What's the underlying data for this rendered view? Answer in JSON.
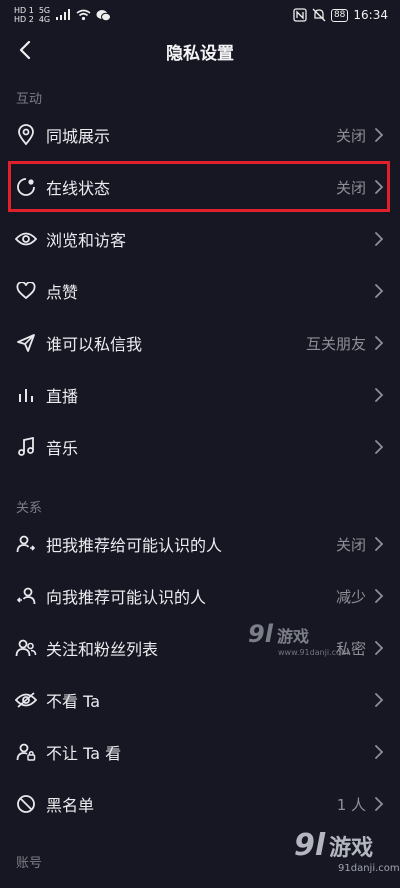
{
  "status_bar": {
    "sim_top": "HD 1",
    "sim_bottom": "HD 2",
    "net_top": "5G",
    "net_bottom": "4G",
    "battery": "88",
    "time": "16:34"
  },
  "header": {
    "title": "隐私设置"
  },
  "sections": {
    "interaction": "互动",
    "relationship": "关系",
    "account": "账号"
  },
  "rows": [
    {
      "label": "同城展示",
      "value": "关闭",
      "icon": "location-pin-icon"
    },
    {
      "label": "在线状态",
      "value": "关闭",
      "icon": "online-status-icon"
    },
    {
      "label": "浏览和访客",
      "value": "",
      "icon": "eye-icon"
    },
    {
      "label": "点赞",
      "value": "",
      "icon": "heart-icon"
    },
    {
      "label": "谁可以私信我",
      "value": "互关朋友",
      "icon": "paper-plane-icon"
    },
    {
      "label": "直播",
      "value": "",
      "icon": "live-bars-icon"
    },
    {
      "label": "音乐",
      "value": "",
      "icon": "music-note-icon"
    },
    {
      "label": "把我推荐给可能认识的人",
      "value": "关闭",
      "icon": "user-share-icon"
    },
    {
      "label": "向我推荐可能认识的人",
      "value": "减少",
      "icon": "user-receive-icon"
    },
    {
      "label": "关注和粉丝列表",
      "value": "私密",
      "icon": "users-icon"
    },
    {
      "label": "不看 Ta",
      "value": "",
      "icon": "eye-off-icon"
    },
    {
      "label": "不让 Ta 看",
      "value": "",
      "icon": "user-lock-icon"
    },
    {
      "label": "黑名单",
      "value": "1 人",
      "icon": "block-icon"
    }
  ],
  "watermarks": {
    "center_logo": "9l",
    "center_cn": "游戏",
    "center_url": "www.91danji.com",
    "corner_logo": "9l",
    "corner_cn": "游戏",
    "corner_url": "91danji.com"
  },
  "colors": {
    "background": "#161722",
    "highlight": "#e0212c",
    "secondary_text": "#8e8e96"
  }
}
